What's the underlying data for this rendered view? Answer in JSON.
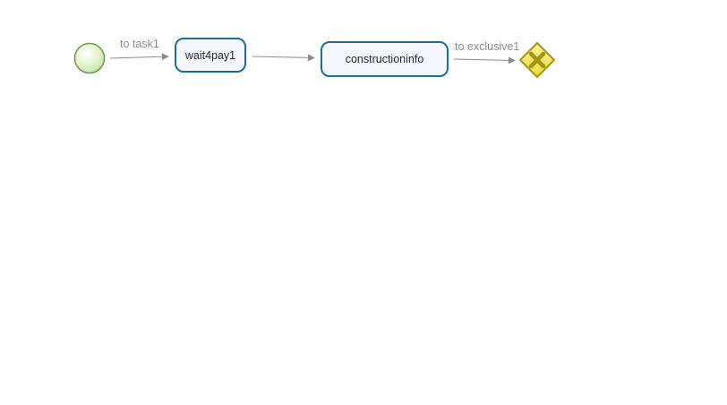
{
  "diagram": {
    "start_event": {
      "type": "start-event"
    },
    "flows": {
      "to_task1": {
        "label": "to task1"
      },
      "task_link": {
        "label": ""
      },
      "to_exclusive1": {
        "label": "to exclusive1"
      }
    },
    "tasks": {
      "wait4pay1": {
        "label": "wait4pay1"
      },
      "constructioninfo": {
        "label": "constructioninfo"
      }
    },
    "gateway": {
      "type": "exclusive-gateway",
      "icon": "x-icon"
    },
    "colors": {
      "task_border": "#1c6c9c",
      "task_fill": "#f5f7fd",
      "flow": "#8a8a8a",
      "start_fill": "#d8f0c0",
      "start_border": "#6d9a4a",
      "gateway_fill": "#f5e25a",
      "gateway_border": "#a49514",
      "gateway_mark": "#a49514"
    }
  }
}
